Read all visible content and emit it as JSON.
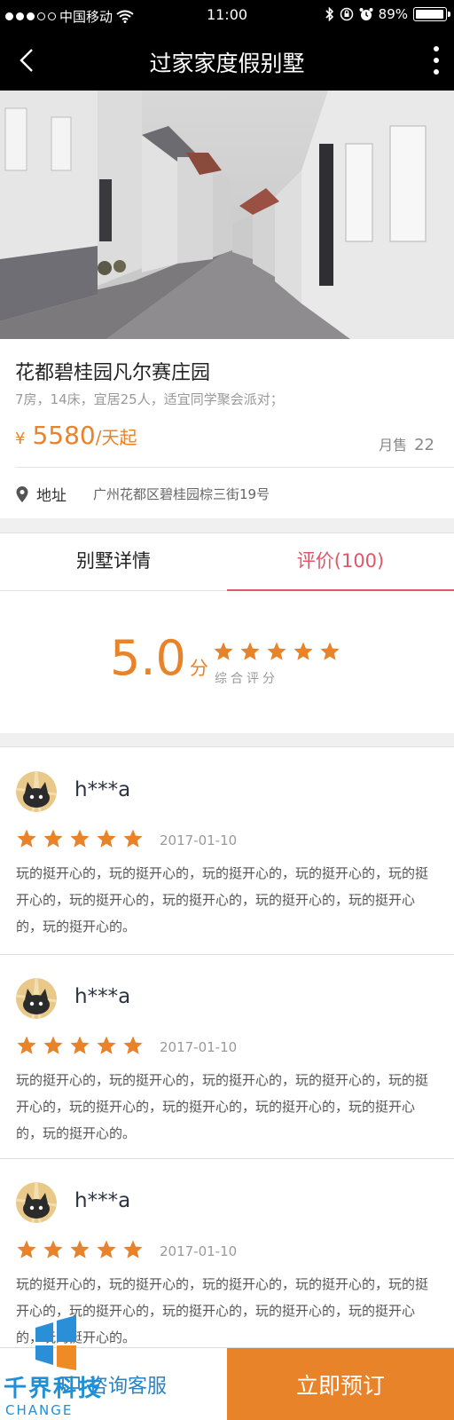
{
  "status_bar": {
    "carrier": "中国移动",
    "time": "11:00",
    "battery": "89%",
    "battery_level": 0.89
  },
  "nav": {
    "title": "过家家度假别墅"
  },
  "villa": {
    "name": "花都碧桂园凡尔赛庄园",
    "description": "7房，14床，宜居25人，适宜同学聚会派对；",
    "price_currency": "¥",
    "price_value": "5580",
    "price_unit": "/天起",
    "sales_label": "月售",
    "sales_count": "22",
    "address_label": "地址",
    "address": "广州花都区碧桂园棕三街19号"
  },
  "tabs": [
    {
      "label": "别墅详情",
      "active": false
    },
    {
      "label": "评价(100)",
      "active": true
    }
  ],
  "rating": {
    "score": "5.0",
    "unit": "分",
    "stars": 5,
    "label": "综合评分"
  },
  "reviews": [
    {
      "user": "h***a",
      "stars": 5,
      "date": "2017-01-10",
      "text": "玩的挺开心的，玩的挺开心的，玩的挺开心的，玩的挺开心的，玩的挺开心的，玩的挺开心的，玩的挺开心的，玩的挺开心的，玩的挺开心的，玩的挺开心的。"
    },
    {
      "user": "h***a",
      "stars": 5,
      "date": "2017-01-10",
      "text": "玩的挺开心的，玩的挺开心的，玩的挺开心的，玩的挺开心的，玩的挺开心的，玩的挺开心的，玩的挺开心的，玩的挺开心的，玩的挺开心的，玩的挺开心的。"
    },
    {
      "user": "h***a",
      "stars": 5,
      "date": "2017-01-10",
      "text": "玩的挺开心的，玩的挺开心的，玩的挺开心的，玩的挺开心的，玩的挺开心的，玩的挺开心的，玩的挺开心的，玩的挺开心的，玩的挺开心的，玩的挺开心的。"
    }
  ],
  "bottom": {
    "consult_label": "咨询客服",
    "book_label": "立即预订"
  },
  "watermark": {
    "brand": "千界科技",
    "brand_en": "CHANGE"
  },
  "colors": {
    "accent_orange": "#e9832a",
    "tab_active": "#e0566b",
    "consult_blue": "#2a83c5"
  },
  "icons": {
    "back": "chevron-left-icon",
    "more": "more-vertical-icon",
    "pin": "location-pin-icon",
    "star": "star-icon",
    "chat": "chat-icon",
    "wifi": "wifi-icon",
    "bluetooth": "bluetooth-icon",
    "alarm": "alarm-icon",
    "lock": "rotation-lock-icon"
  }
}
